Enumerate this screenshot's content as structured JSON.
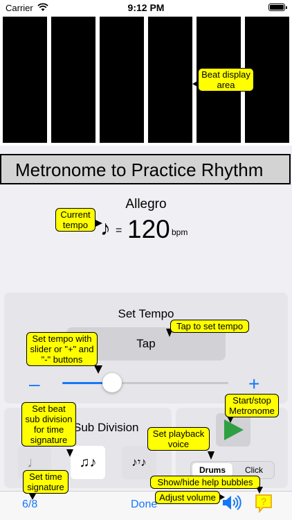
{
  "status": {
    "carrier": "Carrier",
    "time": "9:12 PM"
  },
  "header": {
    "title": "Metronome to Practice Rhythm"
  },
  "tempo": {
    "name": "Allegro",
    "note_glyph": "♪",
    "equals": "=",
    "bpm": "120",
    "unit": "bpm",
    "slider_fraction": 0.3
  },
  "set_tempo": {
    "label": "Set Tempo",
    "tap_label": "Tap",
    "minus_label": "–",
    "plus_label": "+"
  },
  "sub_division": {
    "label": "Sub Division",
    "option_1": "♩",
    "option_2": "♫♪",
    "option_3": "♪𝄾♪"
  },
  "voice": {
    "drums_label": "Drums",
    "click_label": "Click",
    "selected": "Drums"
  },
  "bottom_bar": {
    "time_signature": "6/8",
    "done_label": "Done"
  },
  "help_bubbles": {
    "beat_display": "Beat display area",
    "current_tempo": "Current tempo",
    "tap_to_set": "Tap to set tempo",
    "slider_help": "Set tempo with slider or \"+\" and \"-\" buttons",
    "start_stop": "Start/stop Metronome",
    "sub_division": "Set beat sub division for time signature",
    "playback_voice": "Set playback voice",
    "time_signature": "Set time signature",
    "show_hide": "Show/hide help bubbles",
    "adjust_volume": "Adjust volume"
  },
  "colors": {
    "accent": "#1477f8",
    "bubble": "#ffff00",
    "play": "#2ea043",
    "beat_bar": "#000000"
  }
}
